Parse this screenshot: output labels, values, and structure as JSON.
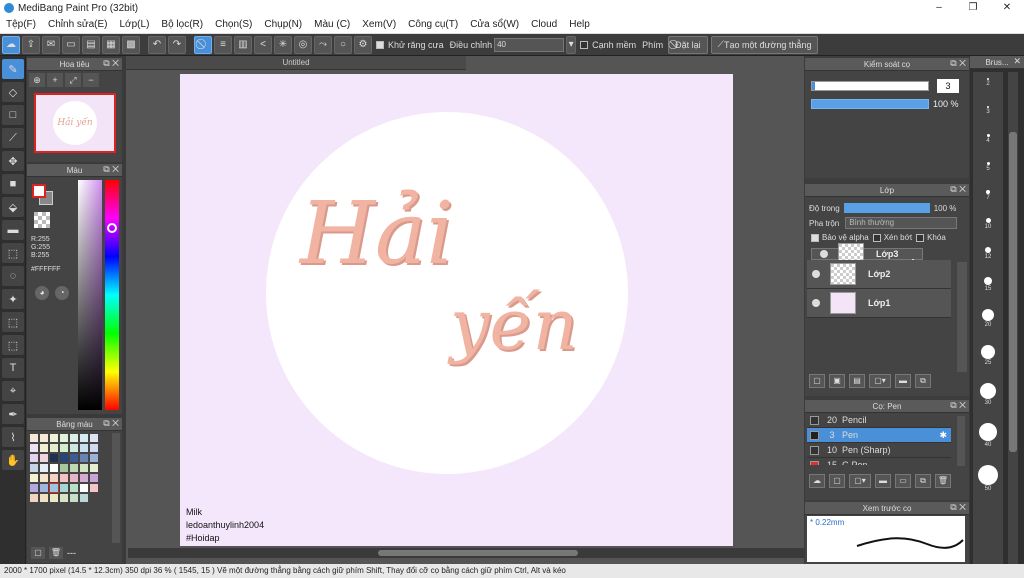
{
  "window": {
    "title": "MediBang Paint Pro (32bit)",
    "minimize": "–",
    "maximize": "❐",
    "close": "✕"
  },
  "menu": [
    "Tệp(F)",
    "Chỉnh sửa(E)",
    "Lớp(L)",
    "Bộ lọc(R)",
    "Chọn(S)",
    "Chụp(N)",
    "Màu (C)",
    "Xem(V)",
    "Công cụ(T)",
    "Cửa sổ(W)",
    "Cloud",
    "Help"
  ],
  "toolbar": {
    "antialias_label": "Khử răng cưa",
    "correction_label": "Điều chỉnh",
    "correction_value": "40",
    "soft_edge_label": "Cạnh mềm",
    "key_label": "Phím",
    "reset_label": "Đặt lại",
    "straight_line_label": "Tạo một đường thẳng"
  },
  "navigator": {
    "title": "Hoa tiêu",
    "thumb_text": "Hải yến"
  },
  "color": {
    "title": "Màu",
    "rgb": "R:255\nG:255\nB:255",
    "hex": "#FFFFFF"
  },
  "palette": {
    "title": "Bảng màu",
    "footer": "---",
    "swatches": [
      "#f6e7d8",
      "#f7ead9",
      "#eef3d8",
      "#e1f1dc",
      "#d9efe8",
      "#d6ecf3",
      "#dfe4f5",
      "#efe3f2",
      "#f3f1d3",
      "#e6edcf",
      "#d6eccf",
      "#cde8e0",
      "#c7e1ef",
      "#d3d9f1",
      "#e2d3ee",
      "#f0d4e0",
      "#1f3050",
      "#27457a",
      "#3d5c94",
      "#6a83b5",
      "#9bb2d4",
      "#c5d4e7",
      "#e7edf5",
      "#ffffff",
      "#a8c8a0",
      "#bfd9b3",
      "#d4e6c1",
      "#e7f0cf",
      "#f4f2d1",
      "#f7e4cc",
      "#f5d1c3",
      "#f2c2c4",
      "#e7b5c8",
      "#d8a9d1",
      "#c7a3da",
      "#b3a7e0",
      "#a1b5e3",
      "#9cc6de",
      "#a7d5d3",
      "#b9e0c6",
      "#ffffff",
      "#f5c6c6",
      "#f3d2bf",
      "#f2e0c2",
      "#eceac6",
      "#d8e5c2",
      "#c5e0c8",
      "#bcd8d6"
    ]
  },
  "document": {
    "tab": "Untitled",
    "lettering_line1": "Hải",
    "lettering_line2": "yến",
    "watermark": [
      "Milk",
      "ledoanthuylinh2004",
      "#Hoidap"
    ]
  },
  "brush_control": {
    "title": "Kiểm soát cọ",
    "size": "3",
    "size_fraction": 0.03,
    "opacity": "100 %"
  },
  "layers": {
    "title": "Lớp",
    "opacity_label": "Độ trong",
    "opacity_value": "100 %",
    "blend_label": "Pha trộn",
    "blend_value": "Bình thường",
    "protect_alpha": "Bảo vệ alpha",
    "clip": "Xén bớt",
    "lock": "Khóa",
    "items": [
      {
        "name": "Lớp3",
        "selected": true
      },
      {
        "name": "Lớp2",
        "selected": false
      },
      {
        "name": "Lớp1",
        "selected": false
      }
    ]
  },
  "brushes": {
    "title": "Cọ: Pen",
    "items": [
      {
        "size": "20",
        "name": "Pencil",
        "color": "#333333",
        "selected": false
      },
      {
        "size": "3",
        "name": "Pen",
        "color": "#222222",
        "selected": true
      },
      {
        "size": "10",
        "name": "Pen (Sharp)",
        "color": "#333333",
        "selected": false
      },
      {
        "size": "15",
        "name": "G Pen",
        "color": "#e03030",
        "selected": false
      }
    ]
  },
  "preview": {
    "title": "Xem trước cọ",
    "size": "* 0.22mm"
  },
  "brush_sizes": {
    "title": "Brus...",
    "items": [
      {
        "label": "2",
        "d": 2
      },
      {
        "label": "3",
        "d": 2
      },
      {
        "label": "4",
        "d": 3
      },
      {
        "label": "5",
        "d": 3
      },
      {
        "label": "7",
        "d": 4
      },
      {
        "label": "10",
        "d": 5
      },
      {
        "label": "12",
        "d": 6
      },
      {
        "label": "15",
        "d": 8
      },
      {
        "label": "20",
        "d": 12
      },
      {
        "label": "25",
        "d": 14
      },
      {
        "label": "30",
        "d": 16
      },
      {
        "label": "40",
        "d": 18
      },
      {
        "label": "50",
        "d": 20
      }
    ]
  },
  "status": "2000 * 1700 pixel   (14.5 * 12.3cm)   350 dpi   36 %   ( 1545, 15 )   Vẽ một đường thẳng bằng cách giữ phím Shift, Thay đổi cỡ cọ bằng cách giữ phím Ctrl, Alt và kéo"
}
